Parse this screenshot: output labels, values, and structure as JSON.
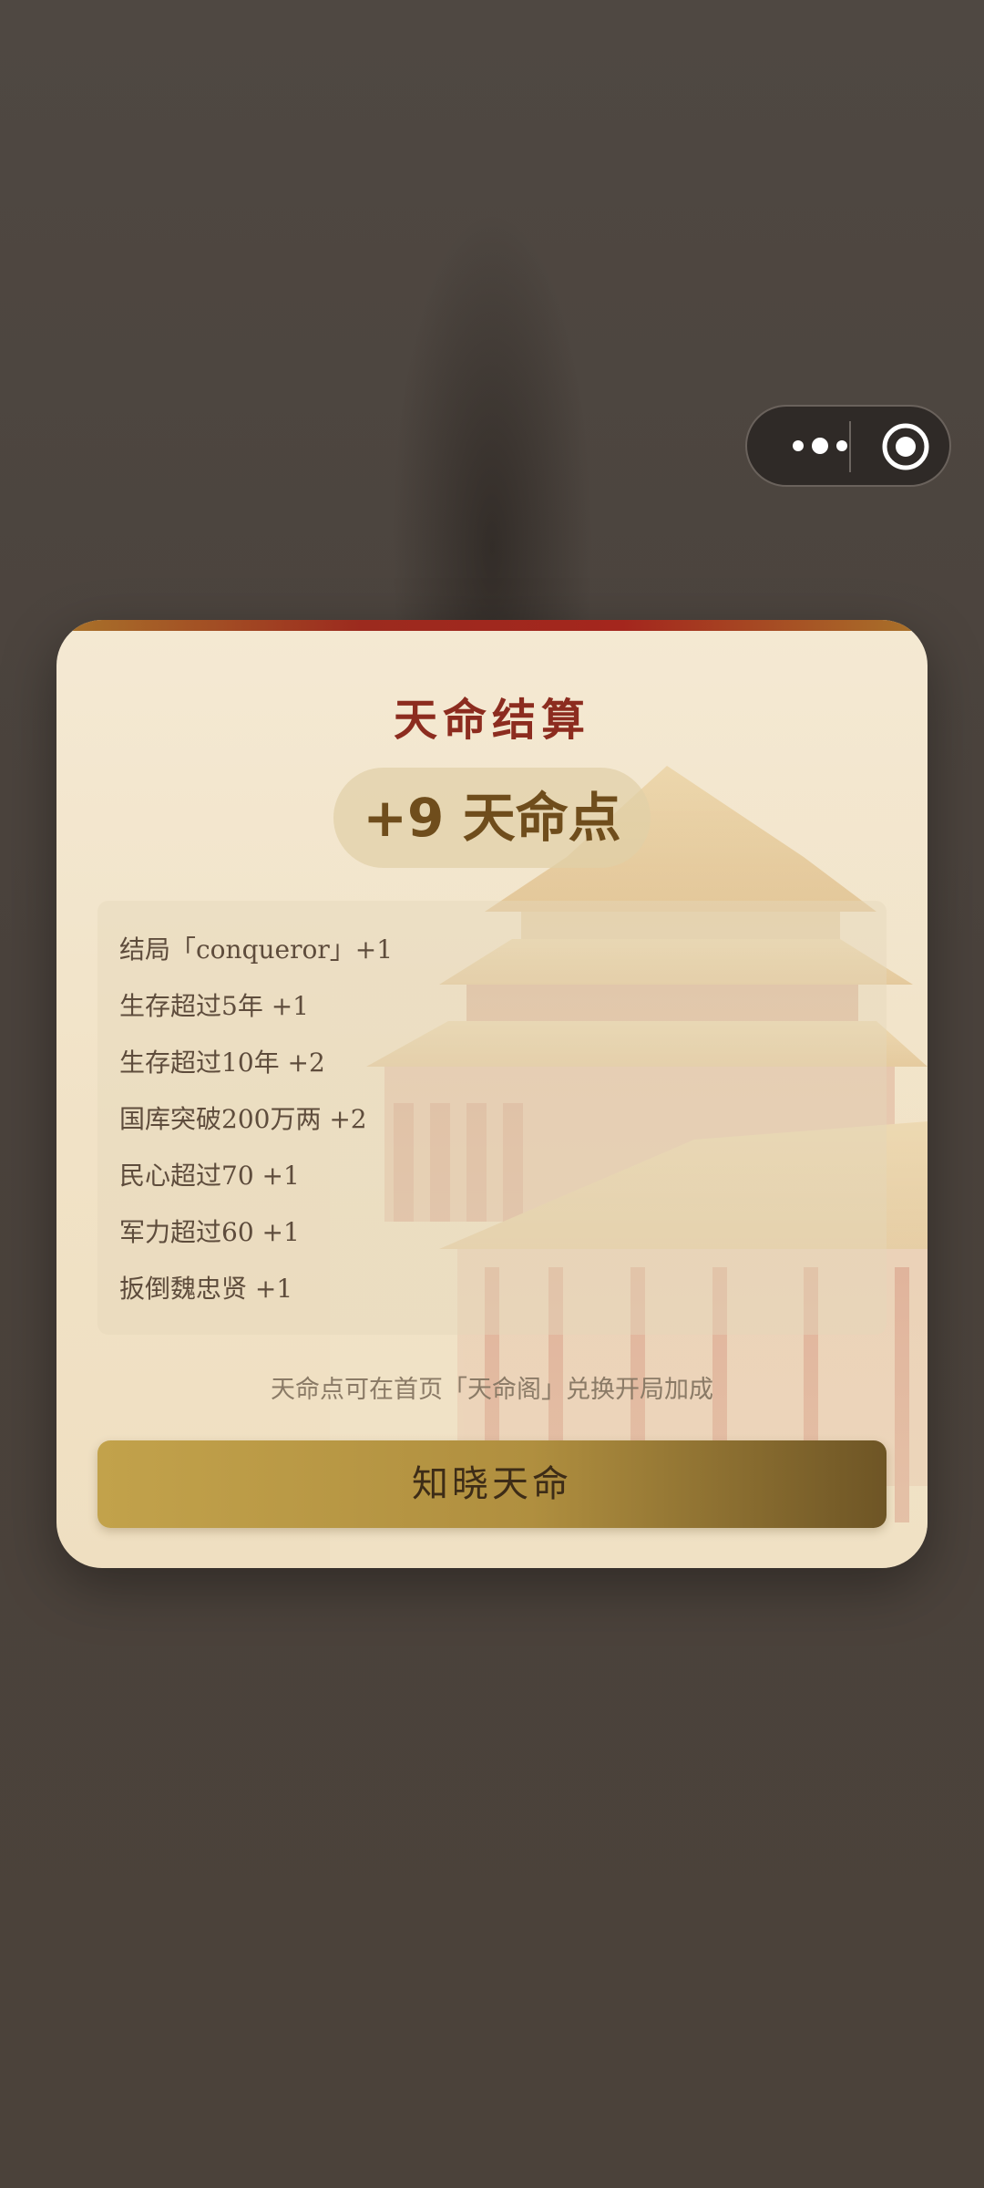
{
  "settlement": {
    "title": "天命结算",
    "points_text": "+9 天命点",
    "items": [
      "结局「conqueror」+1",
      "生存超过5年 +1",
      "生存超过10年 +2",
      "国库突破200万两 +2",
      "民心超过70 +1",
      "军力超过60 +1",
      "扳倒魏忠贤 +1"
    ],
    "note": "天命点可在首页「天命阁」兑换开局加成",
    "confirm_label": "知晓天命"
  },
  "capsule": {
    "more_icon": "more-dots-icon",
    "close_icon": "record-target-icon"
  },
  "colors": {
    "title": "#8c2c1f",
    "points": "#6f4d1c",
    "button_start": "#c2a24b",
    "button_end": "#6e5525",
    "card_bg": "#f4e9d3"
  }
}
